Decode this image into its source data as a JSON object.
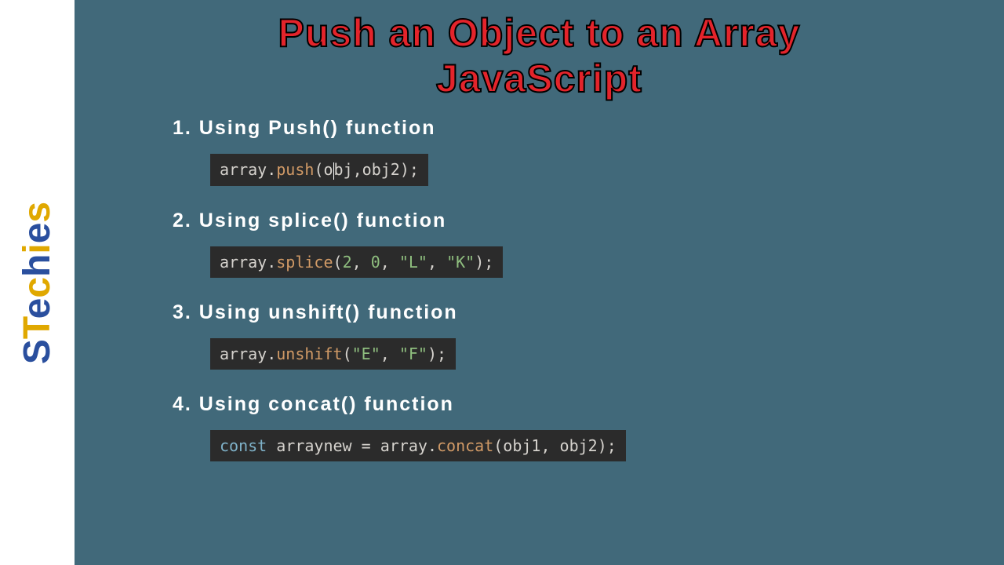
{
  "brand": {
    "letters": [
      "S",
      "T",
      "e",
      "c",
      "h",
      "i",
      "e",
      "s"
    ]
  },
  "title_line1": "Push an Object to an Array",
  "title_line2": "JavaScript",
  "sections": [
    {
      "heading": "1. Using Push() function",
      "code": {
        "obj": "array",
        "method": "push",
        "args_pre": "o",
        "args_post": "bj,obj2",
        "has_cursor": true
      }
    },
    {
      "heading": "2. Using splice() function",
      "code": {
        "obj": "array",
        "method": "splice",
        "num1": "2",
        "num2": "0",
        "str1": "\"L\"",
        "str2": "\"K\""
      }
    },
    {
      "heading": "3. Using unshift() function",
      "code": {
        "obj": "array",
        "method": "unshift",
        "str1": "\"E\"",
        "str2": "\"F\""
      }
    },
    {
      "heading": "4. Using concat() function",
      "code": {
        "kw": "const",
        "varname": "arraynew",
        "obj": "array",
        "method": "concat",
        "arg1": "obj1",
        "arg2": "obj2"
      }
    }
  ]
}
